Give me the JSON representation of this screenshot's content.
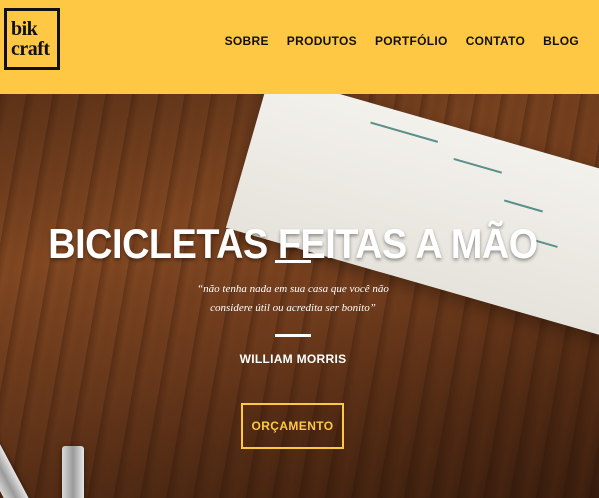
{
  "brand": {
    "logo_line1": "bik",
    "logo_line2": "craft"
  },
  "nav": {
    "items": [
      {
        "label": "SOBRE"
      },
      {
        "label": "PRODUTOS"
      },
      {
        "label": "PORTFÓLIO"
      },
      {
        "label": "CONTATO"
      },
      {
        "label": "BLOG"
      }
    ]
  },
  "hero": {
    "title": "BICICLETAS FEITAS A MÃO",
    "quote_line1": "“não tenha nada em sua casa que você não",
    "quote_line2": "considere útil ou acredita ser bonito”",
    "author": "WILLIAM MORRIS",
    "cta_label": "ORÇAMENTO"
  },
  "colors": {
    "accent": "#fec844",
    "text_dark": "#111111",
    "text_light": "#ffffff"
  }
}
